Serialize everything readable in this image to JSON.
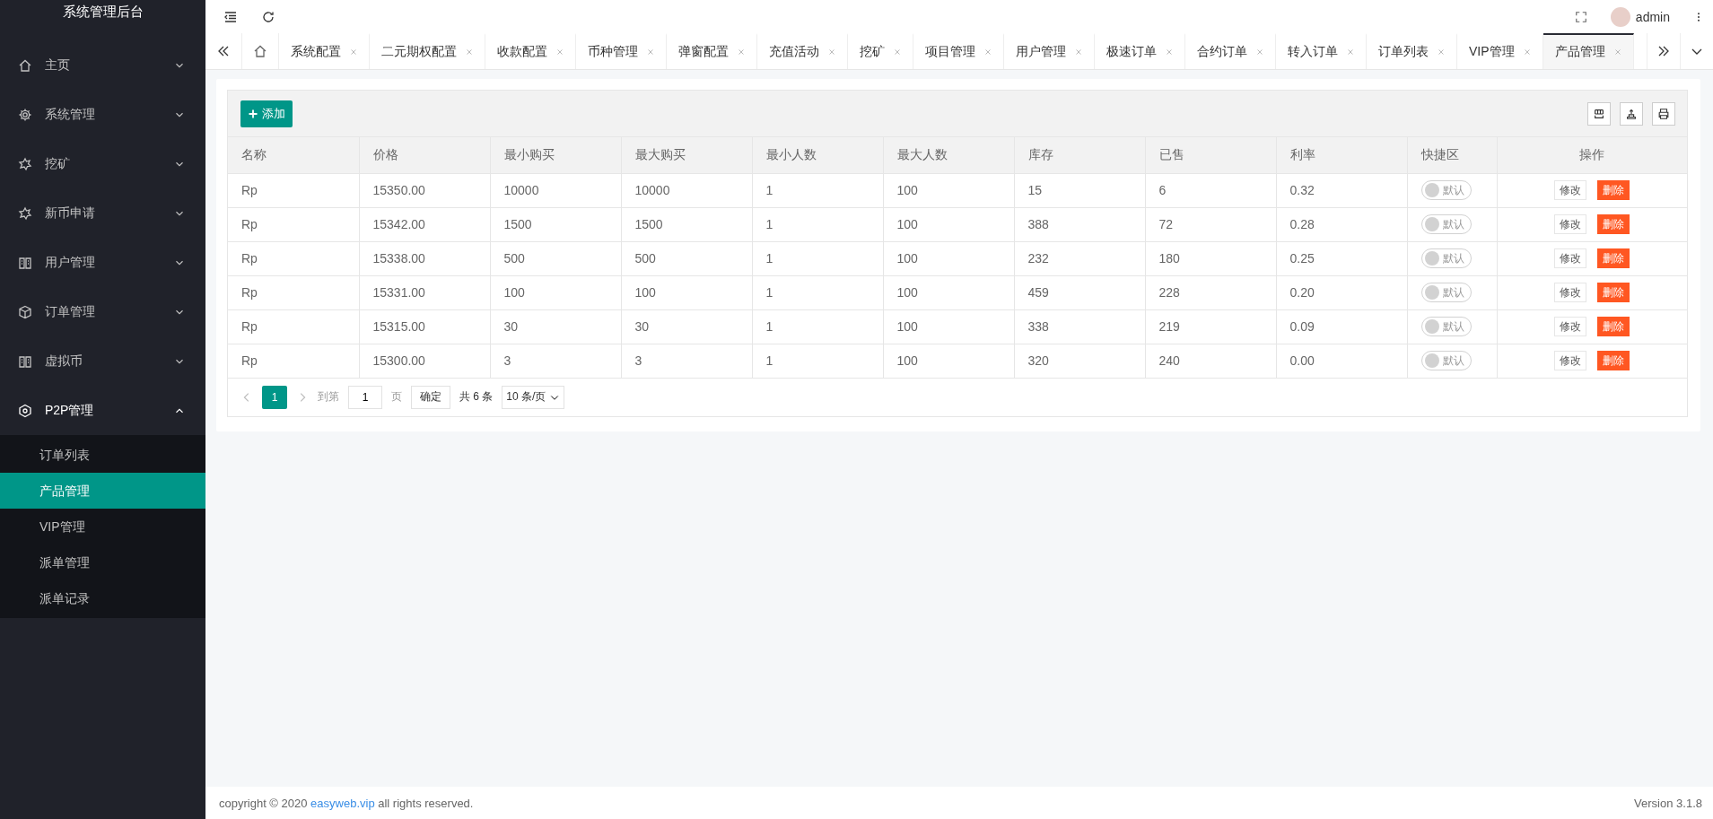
{
  "sidebar": {
    "title": "系统管理后台",
    "items": [
      {
        "label": "主页",
        "kind": "home",
        "expanded": false
      },
      {
        "label": "系统管理",
        "kind": "gear",
        "expanded": false
      },
      {
        "label": "挖矿",
        "kind": "burst",
        "expanded": false
      },
      {
        "label": "新币申请",
        "kind": "burst",
        "expanded": false
      },
      {
        "label": "用户管理",
        "kind": "book",
        "expanded": false
      },
      {
        "label": "订单管理",
        "kind": "cube",
        "expanded": false
      },
      {
        "label": "虚拟币",
        "kind": "book",
        "expanded": false
      },
      {
        "label": "P2P管理",
        "kind": "hexagon",
        "expanded": true,
        "children": [
          {
            "label": "订单列表",
            "selected": false
          },
          {
            "label": "产品管理",
            "selected": true
          },
          {
            "label": "VIP管理",
            "selected": false
          },
          {
            "label": "派单管理",
            "selected": false
          },
          {
            "label": "派单记录",
            "selected": false
          }
        ]
      }
    ]
  },
  "header": {
    "user": "admin"
  },
  "tabs": [
    {
      "label": "系统配置",
      "selected": false
    },
    {
      "label": "二元期权配置",
      "selected": false
    },
    {
      "label": "收款配置",
      "selected": false
    },
    {
      "label": "币种管理",
      "selected": false
    },
    {
      "label": "弹窗配置",
      "selected": false
    },
    {
      "label": "充值活动",
      "selected": false
    },
    {
      "label": "挖矿",
      "selected": false
    },
    {
      "label": "项目管理",
      "selected": false
    },
    {
      "label": "用户管理",
      "selected": false
    },
    {
      "label": "极速订单",
      "selected": false
    },
    {
      "label": "合约订单",
      "selected": false
    },
    {
      "label": "转入订单",
      "selected": false
    },
    {
      "label": "订单列表",
      "selected": false
    },
    {
      "label": "VIP管理",
      "selected": false
    },
    {
      "label": "产品管理",
      "selected": true
    }
  ],
  "table": {
    "add_button": "添加",
    "columns": [
      "名称",
      "价格",
      "最小购买",
      "最大购买",
      "最小人数",
      "最大人数",
      "库存",
      "已售",
      "利率",
      "快捷区",
      "操作"
    ],
    "rows": [
      {
        "cells": [
          "Rp",
          "15350.00",
          "10000",
          "10000",
          "1",
          "100",
          "15",
          "6",
          "0.32"
        ],
        "quick": {
          "label": "默认",
          "on": false
        },
        "actions": [
          {
            "label": "修改",
            "kind": "edit"
          },
          {
            "label": "删除",
            "kind": "delete"
          }
        ]
      },
      {
        "cells": [
          "Rp",
          "15342.00",
          "1500",
          "1500",
          "1",
          "100",
          "388",
          "72",
          "0.28"
        ],
        "quick": {
          "label": "默认",
          "on": false
        },
        "actions": [
          {
            "label": "修改",
            "kind": "edit"
          },
          {
            "label": "删除",
            "kind": "delete"
          }
        ]
      },
      {
        "cells": [
          "Rp",
          "15338.00",
          "500",
          "500",
          "1",
          "100",
          "232",
          "180",
          "0.25"
        ],
        "quick": {
          "label": "默认",
          "on": false
        },
        "actions": [
          {
            "label": "修改",
            "kind": "edit"
          },
          {
            "label": "删除",
            "kind": "delete"
          }
        ]
      },
      {
        "cells": [
          "Rp",
          "15331.00",
          "100",
          "100",
          "1",
          "100",
          "459",
          "228",
          "0.20"
        ],
        "quick": {
          "label": "默认",
          "on": false
        },
        "actions": [
          {
            "label": "修改",
            "kind": "edit"
          },
          {
            "label": "删除",
            "kind": "delete"
          }
        ]
      },
      {
        "cells": [
          "Rp",
          "15315.00",
          "30",
          "30",
          "1",
          "100",
          "338",
          "219",
          "0.09"
        ],
        "quick": {
          "label": "默认",
          "on": false
        },
        "actions": [
          {
            "label": "修改",
            "kind": "edit"
          },
          {
            "label": "删除",
            "kind": "delete"
          }
        ]
      },
      {
        "cells": [
          "Rp",
          "15300.00",
          "3",
          "3",
          "1",
          "100",
          "320",
          "240",
          "0.00"
        ],
        "quick": {
          "label": "默认",
          "on": false
        },
        "actions": [
          {
            "label": "修改",
            "kind": "edit"
          },
          {
            "label": "删除",
            "kind": "delete"
          }
        ]
      }
    ],
    "pagination": {
      "pages": [
        {
          "label": "1",
          "selected": true
        }
      ],
      "goto_label": "到第",
      "goto_value": "1",
      "page_unit": "页",
      "confirm": "确定",
      "total": "共 6 条",
      "page_size": "10 条/页"
    }
  },
  "footer": {
    "copyright": "copyright © 2020 ",
    "link": "easyweb.vip",
    "rest": " all rights reserved.",
    "version": "Version 3.1.8"
  }
}
